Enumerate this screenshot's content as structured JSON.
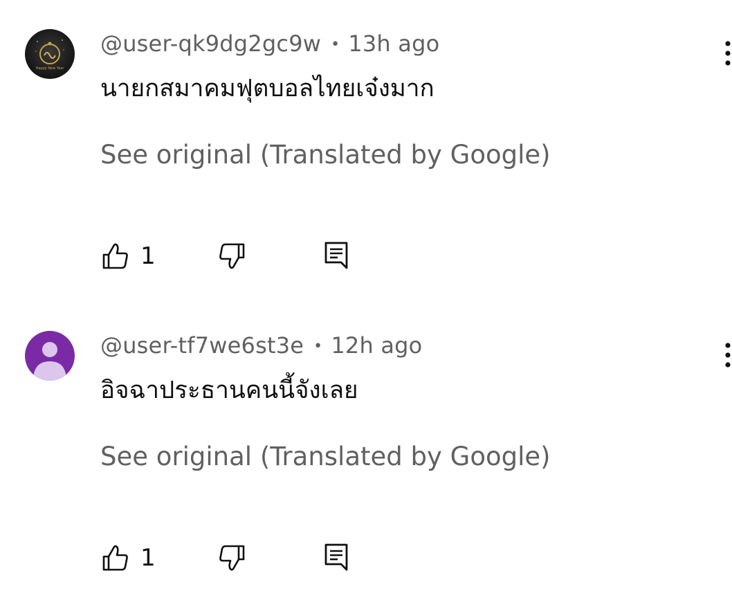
{
  "comments": [
    {
      "author": "@user-qk9dg2gc9w",
      "separator": "•",
      "time": "13h ago",
      "text": "นายกสมาคมฟุตบอลไทยเจ๋งมาก",
      "translate_link": "See original (Translated by Google)",
      "likes": "1",
      "avatar_text": "Happy New Year",
      "avatar_kind": "image-avatar"
    },
    {
      "author": "@user-tf7we6st3e",
      "separator": "•",
      "time": "12h ago",
      "text": "อิจฉาประธานคนนี้จังเลย",
      "translate_link": "See original (Translated by Google)",
      "likes": "1",
      "avatar_kind": "default-person-avatar",
      "avatar_color": "#7b2aa6"
    }
  ],
  "icons": {
    "like": "thumbs-up-icon",
    "dislike": "thumbs-down-icon",
    "reply": "reply-comment-icon",
    "menu": "more-vertical-icon"
  }
}
